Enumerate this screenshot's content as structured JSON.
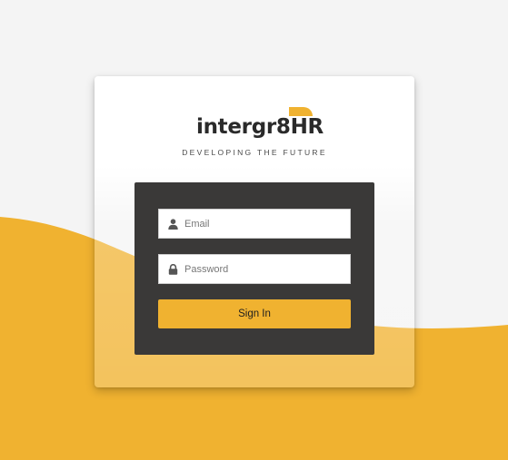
{
  "brand": {
    "name": "intergr8HR",
    "tagline": "DEVELOPING THE FUTURE",
    "accent_color": "#f0b230"
  },
  "form": {
    "email": {
      "placeholder": "Email",
      "value": "",
      "icon": "user-icon"
    },
    "password": {
      "placeholder": "Password",
      "value": "",
      "icon": "lock-icon"
    },
    "submit_label": "Sign In"
  },
  "colors": {
    "background": "#f4f4f4",
    "wave": "#f0b230",
    "panel": "#3a3938"
  }
}
